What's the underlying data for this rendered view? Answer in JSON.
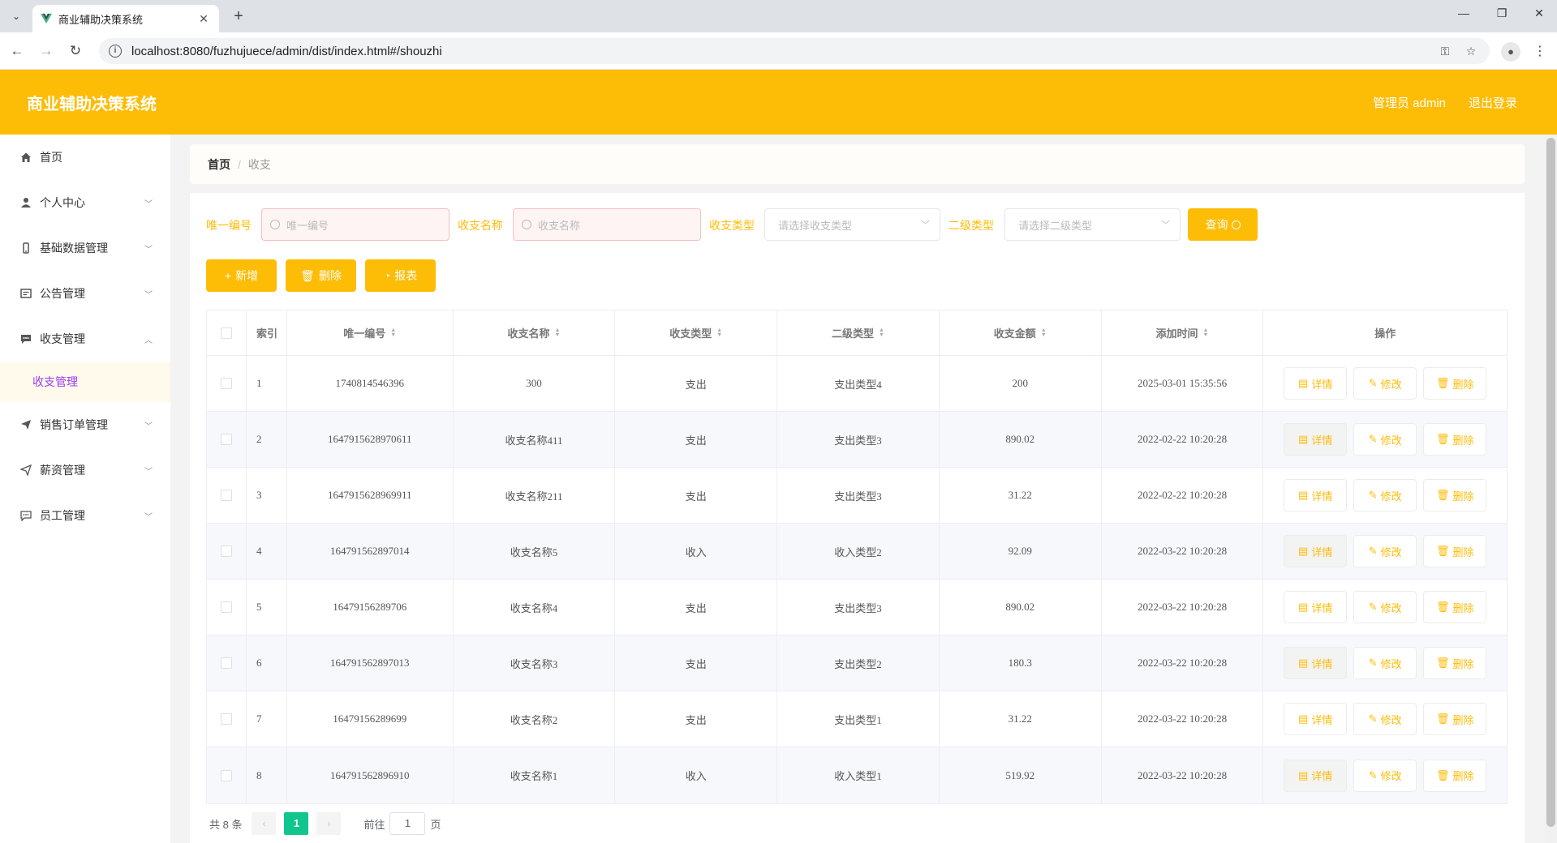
{
  "browser": {
    "tab_title": "商业辅助决策系统",
    "url": "localhost:8080/fuzhujuece/admin/dist/index.html#/shouzhi"
  },
  "header": {
    "title": "商业辅助决策系统",
    "user": "管理员 admin",
    "logout": "退出登录"
  },
  "sidebar": {
    "items": [
      {
        "label": "首页",
        "icon": "home-icon"
      },
      {
        "label": "个人中心",
        "icon": "user-icon"
      },
      {
        "label": "基础数据管理",
        "icon": "phone-icon"
      },
      {
        "label": "公告管理",
        "icon": "notice-icon"
      },
      {
        "label": "收支管理",
        "icon": "chat-icon"
      },
      {
        "label": "销售订单管理",
        "icon": "send-icon"
      },
      {
        "label": "薪资管理",
        "icon": "paper-plane-icon"
      },
      {
        "label": "员工管理",
        "icon": "message-icon"
      }
    ],
    "sub_active": "收支管理"
  },
  "breadcrumb": {
    "home": "首页",
    "sep": "/",
    "current": "收支"
  },
  "search": {
    "no_label": "唯一编号",
    "no_placeholder": "唯一编号",
    "name_label": "收支名称",
    "name_placeholder": "收支名称",
    "type_label": "收支类型",
    "type_placeholder": "请选择收支类型",
    "sub_label": "二级类型",
    "sub_placeholder": "请选择二级类型",
    "query": "查询"
  },
  "actions": {
    "add": "新增",
    "delete": "删除",
    "report": "报表"
  },
  "table": {
    "headers": {
      "idx": "索引",
      "no": "唯一编号",
      "name": "收支名称",
      "type": "收支类型",
      "sub": "二级类型",
      "amount": "收支金额",
      "time": "添加时间",
      "ops": "操作"
    },
    "op_labels": {
      "detail": "详情",
      "edit": "修改",
      "delete": "删除"
    },
    "rows": [
      {
        "idx": "1",
        "no": "1740814546396",
        "name": "300",
        "type": "支出",
        "sub": "支出类型4",
        "amount": "200",
        "time": "2025-03-01 15:35:56"
      },
      {
        "idx": "2",
        "no": "1647915628970611",
        "name": "收支名称411",
        "type": "支出",
        "sub": "支出类型3",
        "amount": "890.02",
        "time": "2022-02-22 10:20:28"
      },
      {
        "idx": "3",
        "no": "1647915628969911",
        "name": "收支名称211",
        "type": "支出",
        "sub": "支出类型3",
        "amount": "31.22",
        "time": "2022-02-22 10:20:28"
      },
      {
        "idx": "4",
        "no": "164791562897014",
        "name": "收支名称5",
        "type": "收入",
        "sub": "收入类型2",
        "amount": "92.09",
        "time": "2022-03-22 10:20:28"
      },
      {
        "idx": "5",
        "no": "16479156289706",
        "name": "收支名称4",
        "type": "支出",
        "sub": "支出类型3",
        "amount": "890.02",
        "time": "2022-03-22 10:20:28"
      },
      {
        "idx": "6",
        "no": "164791562897013",
        "name": "收支名称3",
        "type": "支出",
        "sub": "支出类型2",
        "amount": "180.3",
        "time": "2022-03-22 10:20:28"
      },
      {
        "idx": "7",
        "no": "16479156289699",
        "name": "收支名称2",
        "type": "支出",
        "sub": "支出类型1",
        "amount": "31.22",
        "time": "2022-03-22 10:20:28"
      },
      {
        "idx": "8",
        "no": "164791562896910",
        "name": "收支名称1",
        "type": "收入",
        "sub": "收入类型1",
        "amount": "519.92",
        "time": "2022-03-22 10:20:28"
      }
    ]
  },
  "pager": {
    "total": "共 8 条",
    "current": "1",
    "goto": "前往",
    "page_input": "1",
    "page_unit": "页"
  },
  "colors": {
    "accent": "#fdbc06",
    "page_active": "#10c68c",
    "sub_text": "#9b3cf6"
  }
}
